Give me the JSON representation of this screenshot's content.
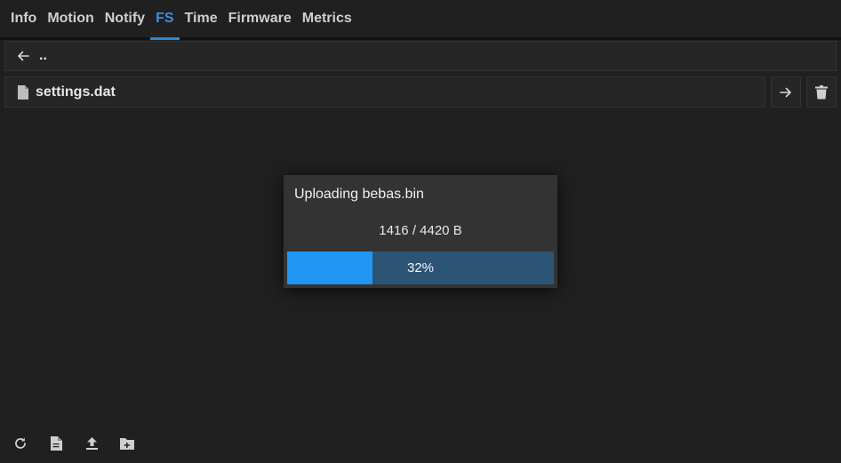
{
  "tabs": [
    {
      "label": "Info",
      "active": false
    },
    {
      "label": "Motion",
      "active": false
    },
    {
      "label": "Notify",
      "active": false
    },
    {
      "label": "FS",
      "active": true
    },
    {
      "label": "Time",
      "active": false
    },
    {
      "label": "Firmware",
      "active": false
    },
    {
      "label": "Metrics",
      "active": false
    }
  ],
  "file_browser": {
    "parent": {
      "label": "..",
      "icon": "arrow-left-icon"
    },
    "entries": [
      {
        "name": "settings.dat",
        "icon": "file-icon"
      }
    ],
    "entry_actions": [
      {
        "name": "open",
        "icon": "arrow-right-icon"
      },
      {
        "name": "delete",
        "icon": "trash-icon"
      }
    ]
  },
  "upload_dialog": {
    "title": "Uploading bebas.bin",
    "bytes": "1416 / 4420 B",
    "progress_label": "32%",
    "progress_fraction": 0.32
  },
  "toolbar": {
    "buttons": [
      {
        "icon": "refresh-icon"
      },
      {
        "icon": "new-file-icon"
      },
      {
        "icon": "upload-icon"
      },
      {
        "icon": "new-folder-icon"
      }
    ]
  },
  "colors": {
    "accent": "#2196f3",
    "active_tab": "#3d8fe0",
    "background": "#202020",
    "progress_track": "#2b5475"
  }
}
